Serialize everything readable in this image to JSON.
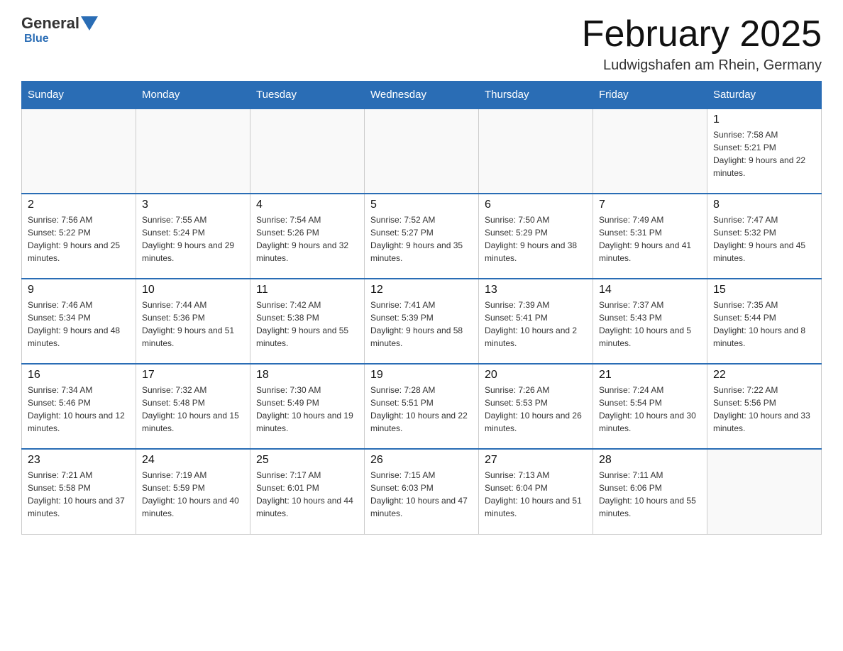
{
  "header": {
    "logo": {
      "general": "General",
      "blue": "Blue"
    },
    "title": "February 2025",
    "location": "Ludwigshafen am Rhein, Germany"
  },
  "weekdays": [
    "Sunday",
    "Monday",
    "Tuesday",
    "Wednesday",
    "Thursday",
    "Friday",
    "Saturday"
  ],
  "weeks": [
    [
      {
        "day": "",
        "info": ""
      },
      {
        "day": "",
        "info": ""
      },
      {
        "day": "",
        "info": ""
      },
      {
        "day": "",
        "info": ""
      },
      {
        "day": "",
        "info": ""
      },
      {
        "day": "",
        "info": ""
      },
      {
        "day": "1",
        "info": "Sunrise: 7:58 AM\nSunset: 5:21 PM\nDaylight: 9 hours and 22 minutes."
      }
    ],
    [
      {
        "day": "2",
        "info": "Sunrise: 7:56 AM\nSunset: 5:22 PM\nDaylight: 9 hours and 25 minutes."
      },
      {
        "day": "3",
        "info": "Sunrise: 7:55 AM\nSunset: 5:24 PM\nDaylight: 9 hours and 29 minutes."
      },
      {
        "day": "4",
        "info": "Sunrise: 7:54 AM\nSunset: 5:26 PM\nDaylight: 9 hours and 32 minutes."
      },
      {
        "day": "5",
        "info": "Sunrise: 7:52 AM\nSunset: 5:27 PM\nDaylight: 9 hours and 35 minutes."
      },
      {
        "day": "6",
        "info": "Sunrise: 7:50 AM\nSunset: 5:29 PM\nDaylight: 9 hours and 38 minutes."
      },
      {
        "day": "7",
        "info": "Sunrise: 7:49 AM\nSunset: 5:31 PM\nDaylight: 9 hours and 41 minutes."
      },
      {
        "day": "8",
        "info": "Sunrise: 7:47 AM\nSunset: 5:32 PM\nDaylight: 9 hours and 45 minutes."
      }
    ],
    [
      {
        "day": "9",
        "info": "Sunrise: 7:46 AM\nSunset: 5:34 PM\nDaylight: 9 hours and 48 minutes."
      },
      {
        "day": "10",
        "info": "Sunrise: 7:44 AM\nSunset: 5:36 PM\nDaylight: 9 hours and 51 minutes."
      },
      {
        "day": "11",
        "info": "Sunrise: 7:42 AM\nSunset: 5:38 PM\nDaylight: 9 hours and 55 minutes."
      },
      {
        "day": "12",
        "info": "Sunrise: 7:41 AM\nSunset: 5:39 PM\nDaylight: 9 hours and 58 minutes."
      },
      {
        "day": "13",
        "info": "Sunrise: 7:39 AM\nSunset: 5:41 PM\nDaylight: 10 hours and 2 minutes."
      },
      {
        "day": "14",
        "info": "Sunrise: 7:37 AM\nSunset: 5:43 PM\nDaylight: 10 hours and 5 minutes."
      },
      {
        "day": "15",
        "info": "Sunrise: 7:35 AM\nSunset: 5:44 PM\nDaylight: 10 hours and 8 minutes."
      }
    ],
    [
      {
        "day": "16",
        "info": "Sunrise: 7:34 AM\nSunset: 5:46 PM\nDaylight: 10 hours and 12 minutes."
      },
      {
        "day": "17",
        "info": "Sunrise: 7:32 AM\nSunset: 5:48 PM\nDaylight: 10 hours and 15 minutes."
      },
      {
        "day": "18",
        "info": "Sunrise: 7:30 AM\nSunset: 5:49 PM\nDaylight: 10 hours and 19 minutes."
      },
      {
        "day": "19",
        "info": "Sunrise: 7:28 AM\nSunset: 5:51 PM\nDaylight: 10 hours and 22 minutes."
      },
      {
        "day": "20",
        "info": "Sunrise: 7:26 AM\nSunset: 5:53 PM\nDaylight: 10 hours and 26 minutes."
      },
      {
        "day": "21",
        "info": "Sunrise: 7:24 AM\nSunset: 5:54 PM\nDaylight: 10 hours and 30 minutes."
      },
      {
        "day": "22",
        "info": "Sunrise: 7:22 AM\nSunset: 5:56 PM\nDaylight: 10 hours and 33 minutes."
      }
    ],
    [
      {
        "day": "23",
        "info": "Sunrise: 7:21 AM\nSunset: 5:58 PM\nDaylight: 10 hours and 37 minutes."
      },
      {
        "day": "24",
        "info": "Sunrise: 7:19 AM\nSunset: 5:59 PM\nDaylight: 10 hours and 40 minutes."
      },
      {
        "day": "25",
        "info": "Sunrise: 7:17 AM\nSunset: 6:01 PM\nDaylight: 10 hours and 44 minutes."
      },
      {
        "day": "26",
        "info": "Sunrise: 7:15 AM\nSunset: 6:03 PM\nDaylight: 10 hours and 47 minutes."
      },
      {
        "day": "27",
        "info": "Sunrise: 7:13 AM\nSunset: 6:04 PM\nDaylight: 10 hours and 51 minutes."
      },
      {
        "day": "28",
        "info": "Sunrise: 7:11 AM\nSunset: 6:06 PM\nDaylight: 10 hours and 55 minutes."
      },
      {
        "day": "",
        "info": ""
      }
    ]
  ]
}
